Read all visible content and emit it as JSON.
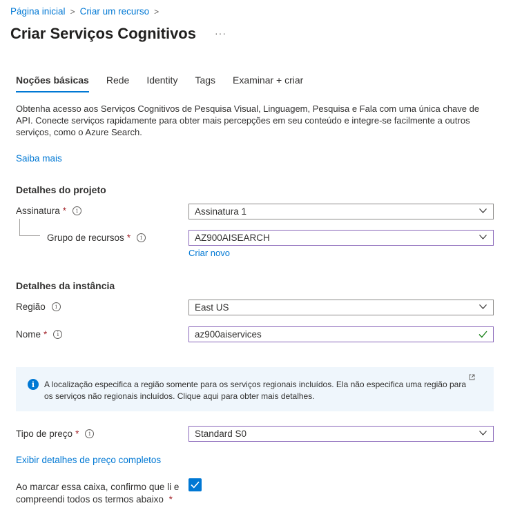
{
  "breadcrumb": {
    "home": "Página inicial",
    "create": "Criar um recurso",
    "separator": ">"
  },
  "page": {
    "title": "Criar Serviços Cognitivos",
    "more": "···"
  },
  "tabs": [
    {
      "label": "Noções básicas",
      "active": true
    },
    {
      "label": "Rede"
    },
    {
      "label": "Identity"
    },
    {
      "label": "Tags"
    },
    {
      "label": "Examinar + criar"
    }
  ],
  "intro": {
    "text": "Obtenha acesso aos Serviços Cognitivos de Pesquisa Visual, Linguagem, Pesquisa e Fala com uma única chave de API. Conecte serviços rapidamente para obter mais percepções em seu conteúdo e integre-se facilmente a outros serviços, como o Azure Search.",
    "learn_more": "Saiba mais"
  },
  "project": {
    "title": "Detalhes do projeto",
    "subscription_label": "Assinatura",
    "subscription_value": "Assinatura 1",
    "rg_label": "Grupo de recursos",
    "rg_value": "AZ900AISEARCH",
    "create_new": "Criar novo"
  },
  "instance": {
    "title": "Detalhes da instância",
    "region_label": "Região",
    "region_value": "East US",
    "name_label": "Nome",
    "name_value": "az900aiservices"
  },
  "info": {
    "text": "A localização especifica a região somente para os serviços regionais incluídos. Ela não especifica uma região para os serviços não regionais incluídos. Clique aqui para obter mais detalhes."
  },
  "pricing": {
    "label": "Tipo de preço",
    "value": "Standard S0",
    "details_link": "Exibir detalhes de preço completos"
  },
  "consent": {
    "text": "Ao marcar essa caixa, confirmo que li e compreendi todos os termos abaixo",
    "checked": true
  },
  "common": {
    "required": "*",
    "info_glyph": "i"
  },
  "colors": {
    "accent": "#0078d4",
    "required": "#a4262c",
    "valid": "#107c10",
    "focus_border": "#8764b8"
  }
}
